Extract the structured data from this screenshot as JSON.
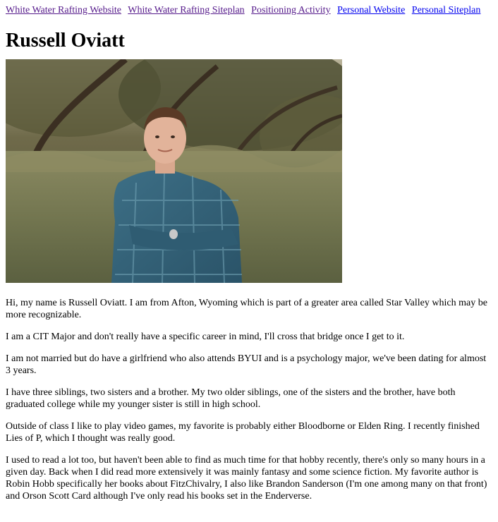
{
  "nav": {
    "links": [
      "White Water Rafting Website",
      "White Water Rafting Siteplan",
      "Positioning Activity",
      "Personal Website",
      "Personal Siteplan"
    ]
  },
  "page_title": "Russell Oviatt",
  "photo_icon": "portrait-photo",
  "paragraphs": [
    "Hi, my name is Russell Oviatt. I am from Afton, Wyoming which is part of a greater area called Star Valley which may be more recognizable.",
    "I am a CIT Major and don't really have a specific career in mind, I'll cross that bridge once I get to it.",
    "I am not married but do have a girlfriend who also attends BYUI and is a psychology major, we've been dating for almost 3 years.",
    "I have three siblings, two sisters and a brother. My two older siblings, one of the sisters and the brother, have both graduated college while my younger sister is still in high school.",
    "Outside of class I like to play video games, my favorite is probably either Bloodborne or Elden Ring. I recently finished Lies of P, which I thought was really good.",
    "I used to read a lot too, but haven't been able to find as much time for that hobby recently, there's only so many hours in a given day. Back when I did read more extensively it was mainly fantasy and some science fiction. My favorite author is Robin Hobb specifically her books about FitzChivalry, I also like Brandon Sanderson (I'm one among many on that front) and Orson Scott Card although I've only read his books set in the Enderverse."
  ],
  "colors": {
    "link_visited": "#551a8b",
    "link_unvisited": "#0000ee"
  }
}
